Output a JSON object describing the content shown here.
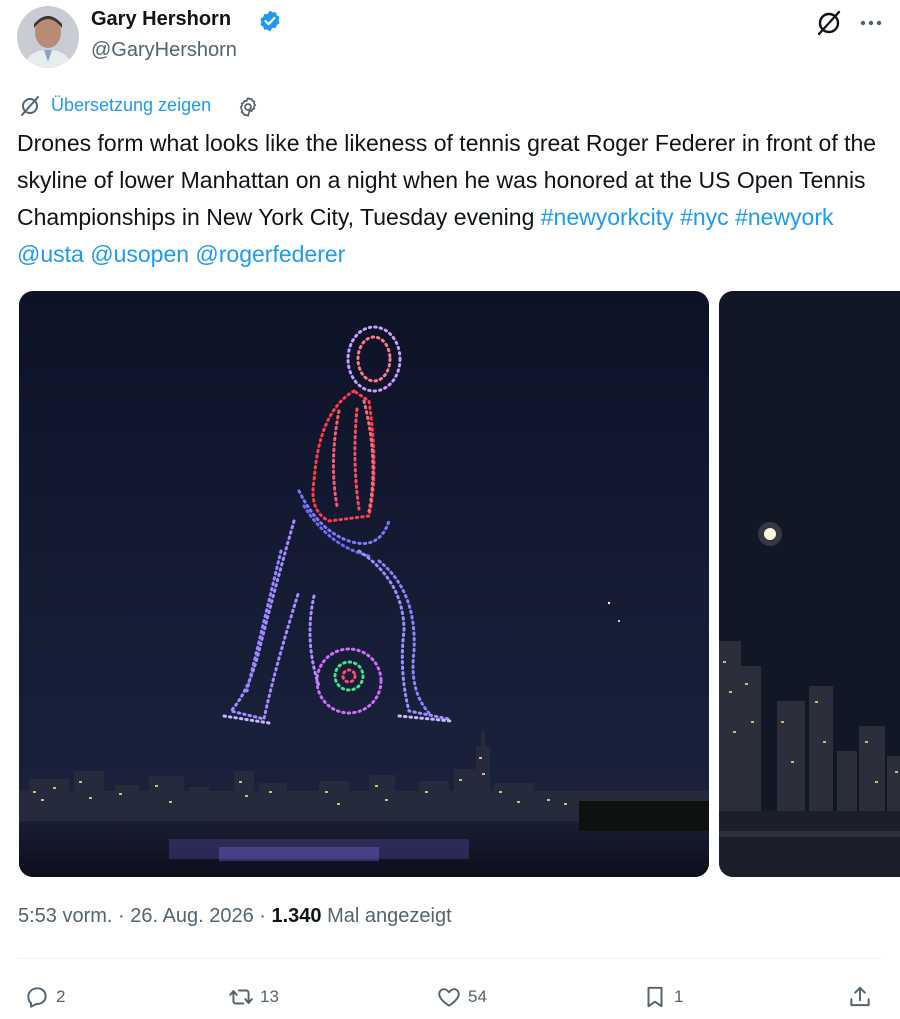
{
  "author": {
    "name": "Gary Hershorn",
    "handle": "@GaryHershorn",
    "verified": true
  },
  "translation": {
    "label": "Übersetzung zeigen"
  },
  "tweet": {
    "text_plain": "Drones form what looks like the likeness of tennis great Roger Federer in front of the skyline of lower Manhattan on a night when he was honored at the US Open Tennis Championships in New York City, Tuesday evening",
    "links": [
      "#newyorkcity",
      "#nyc",
      "#newyork",
      "@usta",
      "@usopen",
      "@rogerfederer"
    ]
  },
  "meta": {
    "time": "5:53 vorm.",
    "date": "26. Aug. 2026",
    "views_count": "1.340",
    "views_label": "Mal angezeigt"
  },
  "actions": {
    "replies": "2",
    "reposts": "13",
    "likes": "54",
    "bookmarks": "1"
  },
  "colors": {
    "accent": "#1d9bf0",
    "secondary_text": "#536471",
    "primary_text": "#0f1419",
    "night_sky": "#131a2e"
  },
  "icons": [
    "verified-badge-icon",
    "grok-icon",
    "more-icon",
    "translate-icon",
    "settings-gear-icon",
    "reply-icon",
    "repost-icon",
    "like-icon",
    "bookmark-icon",
    "share-icon"
  ]
}
